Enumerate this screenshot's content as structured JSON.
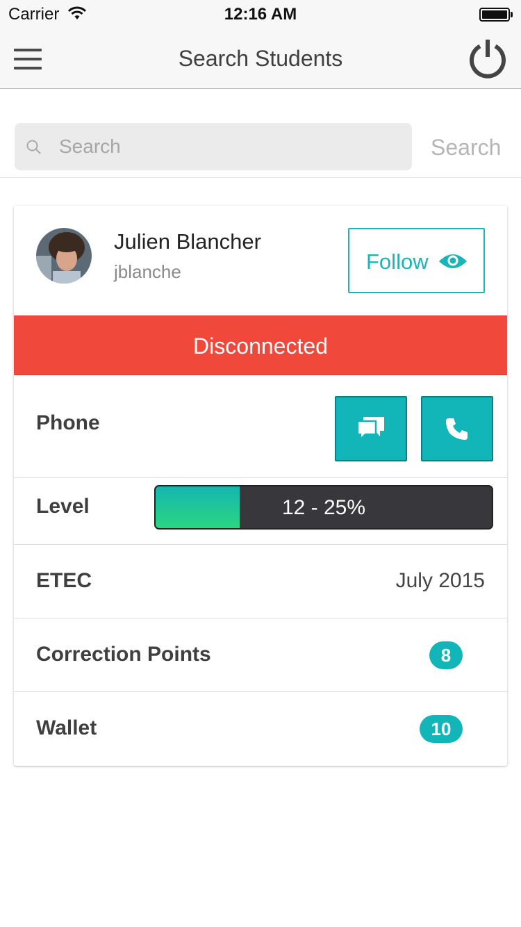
{
  "status_bar": {
    "carrier": "Carrier",
    "time": "12:16 AM",
    "wifi_icon": "wifi-icon",
    "battery_icon": "battery-full-icon"
  },
  "nav": {
    "title": "Search Students",
    "menu_icon": "hamburger-menu-icon",
    "power_icon": "power-icon"
  },
  "search": {
    "placeholder": "Search",
    "value": "",
    "button_label": "Search"
  },
  "student": {
    "name": "Julien Blancher",
    "login": "jblanche",
    "follow_label": "Follow",
    "status": "Disconnected",
    "phone_label": "Phone",
    "level_label": "Level",
    "level_text": "12 - 25%",
    "level_progress": 0.25,
    "etec_label": "ETEC",
    "etec_value": "July 2015",
    "correction_points_label": "Correction Points",
    "correction_points_value": "8",
    "wallet_label": "Wallet",
    "wallet_value": "10"
  },
  "colors": {
    "accent": "#12b5b8",
    "disconnected": "#f0483a",
    "level_bar": "#37373c",
    "level_fill_start": "#15b6b0",
    "level_fill_end": "#2bd680"
  }
}
